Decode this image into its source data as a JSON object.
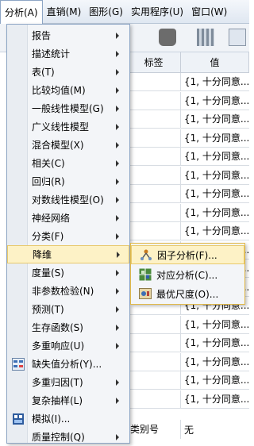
{
  "menubar": {
    "items": [
      {
        "label": "分析(A)"
      },
      {
        "label": "直销(M)"
      },
      {
        "label": "图形(G)"
      },
      {
        "label": "实用程序(U)"
      },
      {
        "label": "窗口(W)"
      }
    ]
  },
  "table": {
    "col_label": "标签",
    "col_value": "值",
    "value_cell": "{1, 十分同意...",
    "last_row": {
      "label": "类别号",
      "value": "无"
    }
  },
  "menu": {
    "items": [
      {
        "label": "报告",
        "submenu": true
      },
      {
        "label": "描述统计",
        "submenu": true
      },
      {
        "label": "表(T)",
        "submenu": true
      },
      {
        "label": "比较均值(M)",
        "submenu": true
      },
      {
        "label": "一般线性模型(G)",
        "submenu": true
      },
      {
        "label": "广义线性模型",
        "submenu": true
      },
      {
        "label": "混合模型(X)",
        "submenu": true
      },
      {
        "label": "相关(C)",
        "submenu": true
      },
      {
        "label": "回归(R)",
        "submenu": true
      },
      {
        "label": "对数线性模型(O)",
        "submenu": true
      },
      {
        "label": "神经网络",
        "submenu": true
      },
      {
        "label": "分类(F)",
        "submenu": true
      },
      {
        "label": "降维",
        "submenu": true
      },
      {
        "label": "度量(S)",
        "submenu": true
      },
      {
        "label": "非参数检验(N)",
        "submenu": true
      },
      {
        "label": "预测(T)",
        "submenu": true
      },
      {
        "label": "生存函数(S)",
        "submenu": true
      },
      {
        "label": "多重响应(U)",
        "submenu": true
      },
      {
        "label": "缺失值分析(Y)...",
        "submenu": false,
        "icon": "missing-values-icon"
      },
      {
        "label": "多重归因(T)",
        "submenu": true
      },
      {
        "label": "复杂抽样(L)",
        "submenu": true
      },
      {
        "label": "模拟(I)...",
        "submenu": false,
        "icon": "simulation-icon"
      },
      {
        "label": "质量控制(Q)",
        "submenu": true
      }
    ]
  },
  "submenu": {
    "items": [
      {
        "label": "因子分析(F)...",
        "icon": "factor-analysis-icon"
      },
      {
        "label": "对应分析(C)...",
        "icon": "correspondence-analysis-icon"
      },
      {
        "label": "最优尺度(O)...",
        "icon": "optimal-scaling-icon"
      }
    ]
  },
  "colors": {
    "highlight": "#fdf2c6",
    "highlight_border": "#e8c96c",
    "menu_bg": "#f3f5f8"
  }
}
